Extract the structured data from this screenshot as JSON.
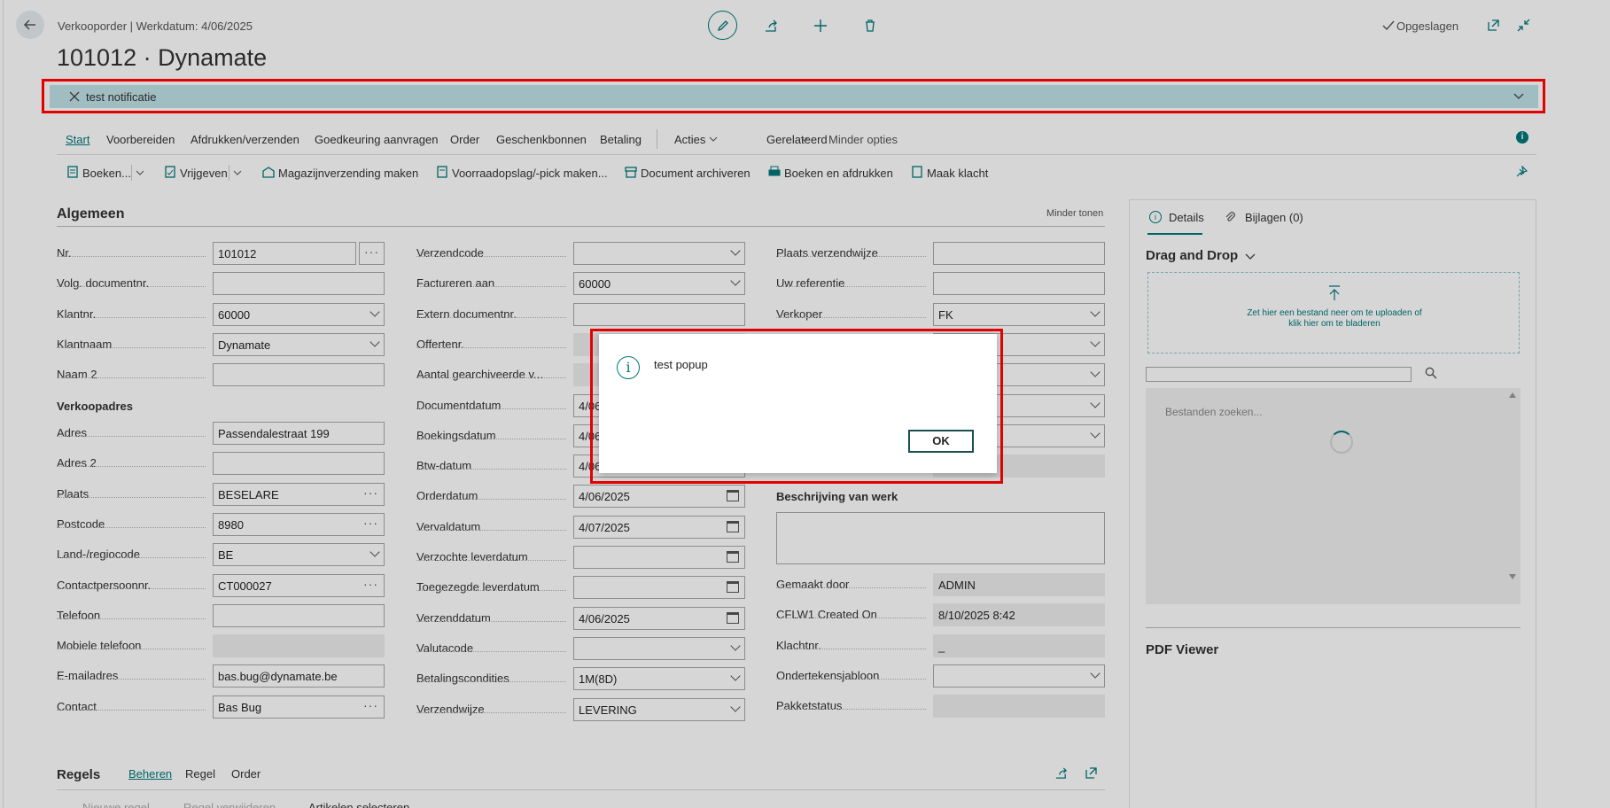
{
  "header": {
    "breadcrumb": "Verkooporder | Werkdatum: 4/06/2025",
    "title": "101012 · Dynamate",
    "saved": "Opgeslagen"
  },
  "notification": {
    "text": "test notificatie"
  },
  "tabs": [
    "Start",
    "Voorbereiden",
    "Afdrukken/verzenden",
    "Goedkeuring aanvragen",
    "Order",
    "Geschenkbonnen",
    "Betaling",
    "Acties",
    "Gerelateerd",
    "Minder opties"
  ],
  "actions": [
    "Boeken...",
    "Vrijgeven",
    "Magazijnverzending maken",
    "Voorraadopslag/-pick maken...",
    "Document archiveren",
    "Boeken en afdrukken",
    "Maak klacht"
  ],
  "general": {
    "title": "Algemeen",
    "show_less": "Minder tonen",
    "col1": [
      {
        "label": "Nr.",
        "value": "101012",
        "type": "ellipsis"
      },
      {
        "label": "Volg. documentnr.",
        "value": "",
        "type": "text"
      },
      {
        "label": "Klantnr.",
        "value": "60000",
        "type": "dropdown"
      },
      {
        "label": "Klantnaam",
        "value": "Dynamate",
        "type": "dropdown"
      },
      {
        "label": "Naam 2",
        "value": "",
        "type": "text"
      }
    ],
    "address_section": "Verkoopadres",
    "col1b": [
      {
        "label": "Adres",
        "value": "Passendalestraat 199",
        "type": "text"
      },
      {
        "label": "Adres 2",
        "value": "",
        "type": "text"
      },
      {
        "label": "Plaats",
        "value": "BESELARE",
        "type": "ellipsis"
      },
      {
        "label": "Postcode",
        "value": "8980",
        "type": "ellipsis"
      },
      {
        "label": "Land-/regiocode",
        "value": "BE",
        "type": "dropdown"
      },
      {
        "label": "Contactpersoonnr.",
        "value": "CT000027",
        "type": "ellipsis"
      },
      {
        "label": "Telefoon",
        "value": "",
        "type": "text"
      },
      {
        "label": "Mobiele telefoon",
        "value": "",
        "type": "readonly"
      },
      {
        "label": "E-mailadres",
        "value": "bas.bug@dynamate.be",
        "type": "text"
      },
      {
        "label": "Contact",
        "value": "Bas Bug",
        "type": "ellipsis"
      }
    ],
    "col2": [
      {
        "label": "Verzendcode",
        "value": "",
        "type": "dropdown"
      },
      {
        "label": "Factureren aan",
        "value": "60000",
        "type": "dropdown"
      },
      {
        "label": "Extern documentnr.",
        "value": "",
        "type": "text"
      },
      {
        "label": "Offertenr.",
        "value": "",
        "type": "readonly"
      },
      {
        "label": "Aantal gearchiveerde v...",
        "value": "",
        "type": "readonly"
      },
      {
        "label": "Documentdatum",
        "value": "4/06/2025",
        "type": "date"
      },
      {
        "label": "Boekingsdatum",
        "value": "4/06/2025",
        "type": "date"
      },
      {
        "label": "Btw-datum",
        "value": "4/06/2025",
        "type": "date"
      },
      {
        "label": "Orderdatum",
        "value": "4/06/2025",
        "type": "date"
      },
      {
        "label": "Vervaldatum",
        "value": "4/07/2025",
        "type": "date"
      },
      {
        "label": "Verzochte leverdatum",
        "value": "",
        "type": "date"
      },
      {
        "label": "Toegezegde leverdatum",
        "value": "",
        "type": "date"
      },
      {
        "label": "Verzenddatum",
        "value": "4/06/2025",
        "type": "date"
      },
      {
        "label": "Valutacode",
        "value": "",
        "type": "dropdown"
      },
      {
        "label": "Betalingscondities",
        "value": "1M(8D)",
        "type": "dropdown"
      },
      {
        "label": "Verzendwijze",
        "value": "LEVERING",
        "type": "dropdown"
      }
    ],
    "col3": [
      {
        "label": "Plaats verzendwijze",
        "value": "",
        "type": "text"
      },
      {
        "label": "Uw referentie",
        "value": "",
        "type": "text"
      },
      {
        "label": "Verkoper",
        "value": "FK",
        "type": "dropdown"
      },
      {
        "label": "",
        "value": "",
        "type": "dropdown"
      },
      {
        "label": "",
        "value": "",
        "type": "dropdown"
      },
      {
        "label": "",
        "value": "",
        "type": "dropdown"
      },
      {
        "label": "",
        "value": "",
        "type": "dropdown"
      },
      {
        "label": "",
        "value": "",
        "type": "readonly"
      }
    ],
    "work_desc": "Beschrijving van werk",
    "col3b": [
      {
        "label": "Gemaakt door",
        "value": "ADMIN",
        "type": "readonly"
      },
      {
        "label": "CFLW1 Created On",
        "value": "8/10/2025 8:42",
        "type": "readonly"
      },
      {
        "label": "Klachtnr.",
        "value": "_",
        "type": "readonly"
      },
      {
        "label": "Ondertekensjabloon",
        "value": "",
        "type": "dropdown"
      },
      {
        "label": "Pakketstatus",
        "value": "",
        "type": "readonly"
      }
    ]
  },
  "lines": {
    "title": "Regels",
    "tabs": [
      "Beheren",
      "Regel",
      "Order"
    ],
    "actions": [
      "Nieuwe regel",
      "Regel verwijderen",
      "Artikelen selecteren"
    ]
  },
  "factbox": {
    "tabs": [
      "Details",
      "Bijlagen (0)"
    ],
    "dnd_title": "Drag and Drop",
    "drop_text1": "Zet hier een bestand neer om te uploaden of",
    "drop_text2": "klik hier om te bladeren",
    "search_placeholder": "Bestanden zoeken...",
    "pdf_title": "PDF Viewer"
  },
  "dialog": {
    "message": "test popup",
    "ok": "OK"
  },
  "colors": {
    "accent": "#00787a",
    "notification": "#bfe2e6",
    "highlight": "#e30000"
  }
}
